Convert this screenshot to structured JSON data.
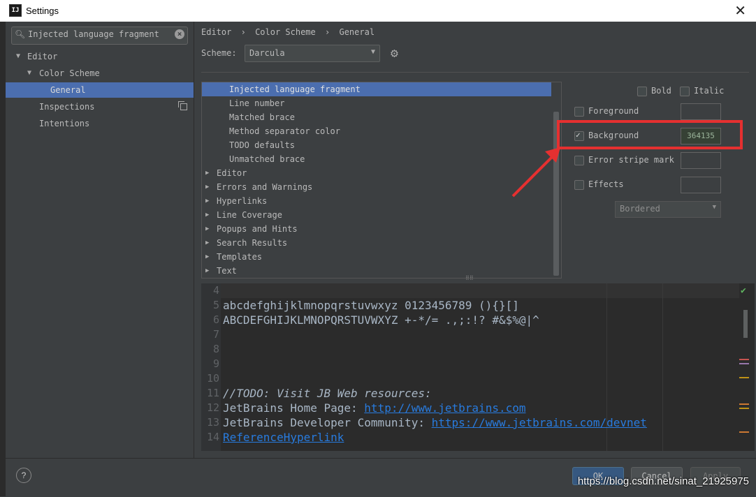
{
  "window": {
    "title": "Settings",
    "icon_text": "IJ",
    "close_glyph": "✕"
  },
  "search": {
    "value": "Injected language fragment"
  },
  "sidebar": {
    "items": [
      {
        "label": "Editor",
        "expanded": true
      },
      {
        "label": "Color Scheme",
        "expanded": true
      },
      {
        "label": "General",
        "selected": true
      },
      {
        "label": "Inspections"
      },
      {
        "label": "Intentions"
      }
    ]
  },
  "breadcrumb": {
    "part1": "Editor",
    "part2": "Color Scheme",
    "part3": "General",
    "sep": "›"
  },
  "scheme": {
    "label": "Scheme:",
    "value": "Darcula"
  },
  "list": {
    "children": [
      "Injected language fragment",
      "Line number",
      "Matched brace",
      "Method separator color",
      "TODO defaults",
      "Unmatched brace"
    ],
    "groups": [
      "Editor",
      "Errors and Warnings",
      "Hyperlinks",
      "Line Coverage",
      "Popups and Hints",
      "Search Results",
      "Templates",
      "Text"
    ]
  },
  "options": {
    "bold": "Bold",
    "italic": "Italic",
    "foreground": "Foreground",
    "background": "Background",
    "background_value": "364135",
    "background_checked": true,
    "error_stripe": "Error stripe mark",
    "effects": "Effects",
    "effect_type": "Bordered"
  },
  "preview": {
    "lines": [
      {
        "num": "4",
        "text": ""
      },
      {
        "num": "5",
        "text": "abcdefghijklmnopqrstuvwxyz 0123456789 (){}[]"
      },
      {
        "num": "6",
        "text": "ABCDEFGHIJKLMNOPQRSTUVWXYZ +-*/= .,;:!? #&$%@|^"
      },
      {
        "num": "7",
        "text": ""
      },
      {
        "num": "8",
        "text": ""
      },
      {
        "num": "9",
        "text": ""
      },
      {
        "num": "10",
        "text": ""
      },
      {
        "num": "11",
        "text": "//TODO: Visit JB Web resources:"
      },
      {
        "num": "12",
        "text": "JetBrains Home Page: ",
        "link": "http://www.jetbrains.com"
      },
      {
        "num": "13",
        "text": "JetBrains Developer Community: ",
        "link": "https://www.jetbrains.com/devnet"
      },
      {
        "num": "14",
        "text": "",
        "link": "ReferenceHyperlink"
      }
    ]
  },
  "buttons": {
    "ok": "OK",
    "cancel": "Cancel",
    "apply": "Apply",
    "help": "?"
  },
  "watermark": "https://blog.csdn.net/sinat_21925975",
  "colors": {
    "accent": "#4b6eaf",
    "highlight": "#e53030",
    "background_swatch": "#364135",
    "todo": "#a8c023",
    "link": "#287bde"
  }
}
